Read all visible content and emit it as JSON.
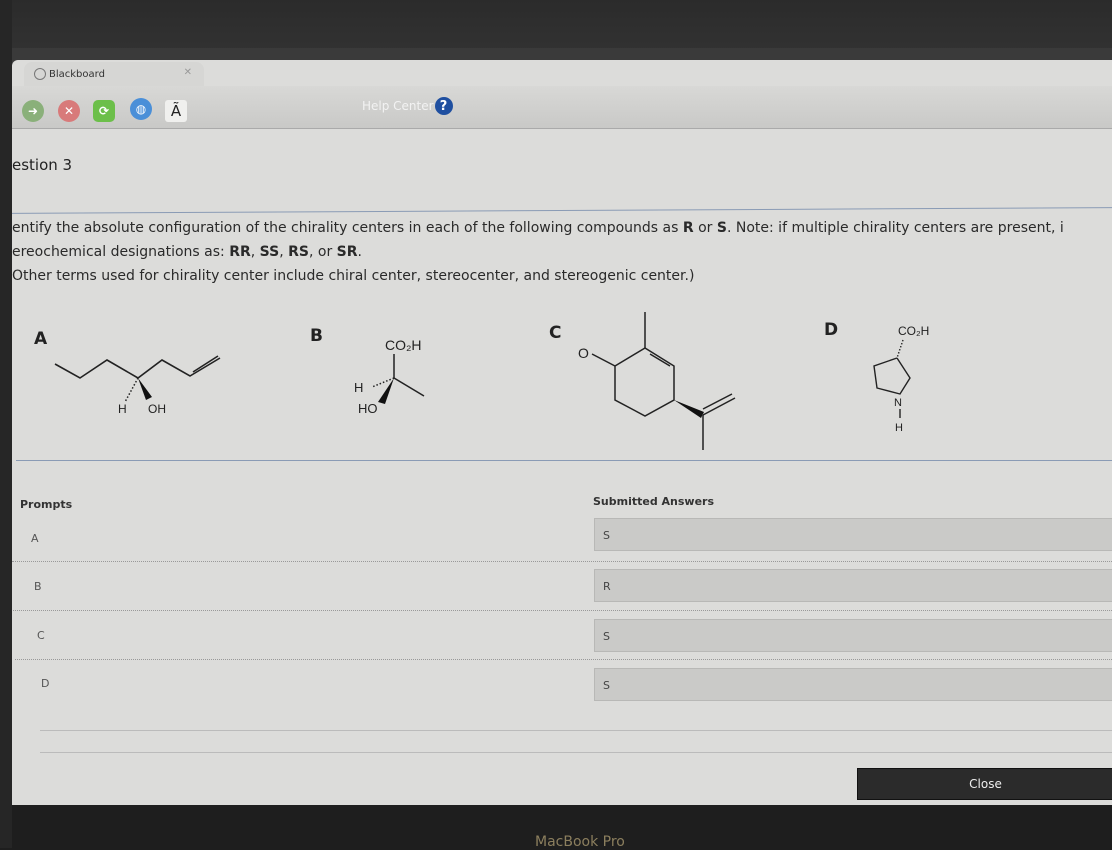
{
  "browser": {
    "tab_title": "Blackboard",
    "toolbar": {
      "back_icon": "arrow-right-icon",
      "stop_icon": "x-icon",
      "refresh_icon": "refresh-icon",
      "globe_icon": "globe-icon",
      "text_icon_glyph": "Ã",
      "help_label": "Help Center",
      "help_glyph": "?"
    }
  },
  "question": {
    "title": "estion 3",
    "instructions": {
      "line1_pre": "entify the absolute configuration of the chirality centers in each of the following compounds as ",
      "line1_r": "R",
      "line1_or": " or ",
      "line1_s": "S",
      "line1_post": ". Note: if multiple chirality centers are present, i",
      "line2_pre": "ereochemical designations as: ",
      "line2_rr": "RR",
      "line2_ss": "SS",
      "line2_rs": "RS",
      "line2_or": ", or ",
      "line2_sr": "SR",
      "line2_sep": ", ",
      "line2_end": ".",
      "line3": "Other terms used for chirality center include chiral center, stereocenter, and stereogenic center.)"
    },
    "molecules": [
      {
        "label": "A",
        "atoms": {
          "h": "H",
          "oh": "OH"
        }
      },
      {
        "label": "B",
        "atoms": {
          "top": "CO₂H",
          "h": "H",
          "ho": "HO"
        }
      },
      {
        "label": "C",
        "atoms": {
          "o": "O"
        }
      },
      {
        "label": "D",
        "atoms": {
          "top": "CO₂H",
          "n": "N",
          "h": "H"
        }
      }
    ]
  },
  "results": {
    "prompts_header": "Prompts",
    "answers_header": "Submitted Answers",
    "rows": [
      {
        "prompt": "A",
        "answer": "S"
      },
      {
        "prompt": "B",
        "answer": "R"
      },
      {
        "prompt": "C",
        "answer": "S"
      },
      {
        "prompt": "D",
        "answer": "S"
      }
    ]
  },
  "footer": {
    "close_label": "Close",
    "device_label": "MacBook Pro"
  }
}
